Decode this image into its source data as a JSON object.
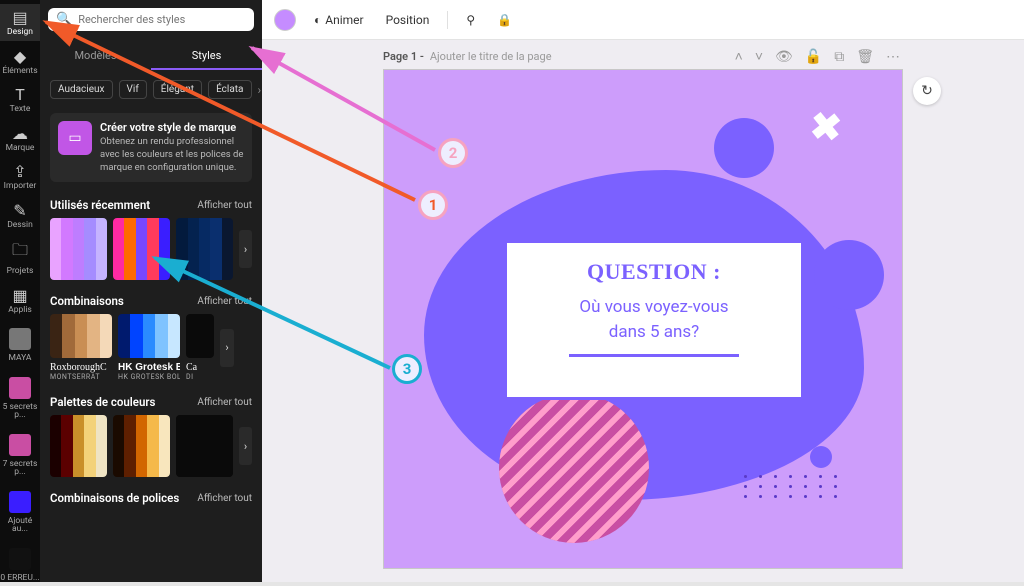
{
  "rail": {
    "items": [
      {
        "label": "Design",
        "icon": "⌂"
      },
      {
        "label": "Éléments",
        "icon": "✦"
      },
      {
        "label": "Texte",
        "icon": "T"
      },
      {
        "label": "Marque",
        "icon": "☁"
      },
      {
        "label": "Importer",
        "icon": "⇪"
      },
      {
        "label": "Dessin",
        "icon": "✎"
      },
      {
        "label": "Projets",
        "icon": "🗀"
      },
      {
        "label": "Applis",
        "icon": "⋮⋮"
      }
    ],
    "extras": [
      {
        "label": "MAYA"
      },
      {
        "label": "5 secrets p..."
      },
      {
        "label": "7 secrets p..."
      },
      {
        "label": "Ajouté au..."
      },
      {
        "label": "0 ERREU..."
      }
    ]
  },
  "search": {
    "placeholder": "Rechercher des styles"
  },
  "tabs": {
    "models": "Modèles",
    "styles": "Styles"
  },
  "chips": [
    "Audacieux",
    "Vif",
    "Élégant",
    "Éclata"
  ],
  "brand": {
    "title": "Créer votre style de marque",
    "desc": "Obtenez un rendu professionnel avec les couleurs et les polices de marque en configuration unique."
  },
  "sections": {
    "recent": {
      "title": "Utilisés récemment",
      "all": "Afficher tout"
    },
    "combos": {
      "title": "Combinaisons",
      "all": "Afficher tout",
      "items": [
        {
          "title": "RoxboroughC",
          "sub": "MONTSERRAT"
        },
        {
          "title": "HK Grotesk B",
          "sub": "HK GROTESK BOLD"
        },
        {
          "title": "Ca",
          "sub": "Di"
        }
      ]
    },
    "palettes": {
      "title": "Palettes de couleurs",
      "all": "Afficher tout"
    },
    "fonts": {
      "title": "Combinaisons de polices",
      "all": "Afficher tout"
    }
  },
  "topbar": {
    "animate": "Animer",
    "position": "Position"
  },
  "page": {
    "label": "Page 1 -",
    "title_hint": "Ajouter le titre de la page"
  },
  "card": {
    "question": "QUESTION :",
    "text_l1": "Où vous voyez-vous",
    "text_l2": "dans 5 ans?"
  },
  "annotations": {
    "l1": "1",
    "l2": "2",
    "l3": "3"
  }
}
